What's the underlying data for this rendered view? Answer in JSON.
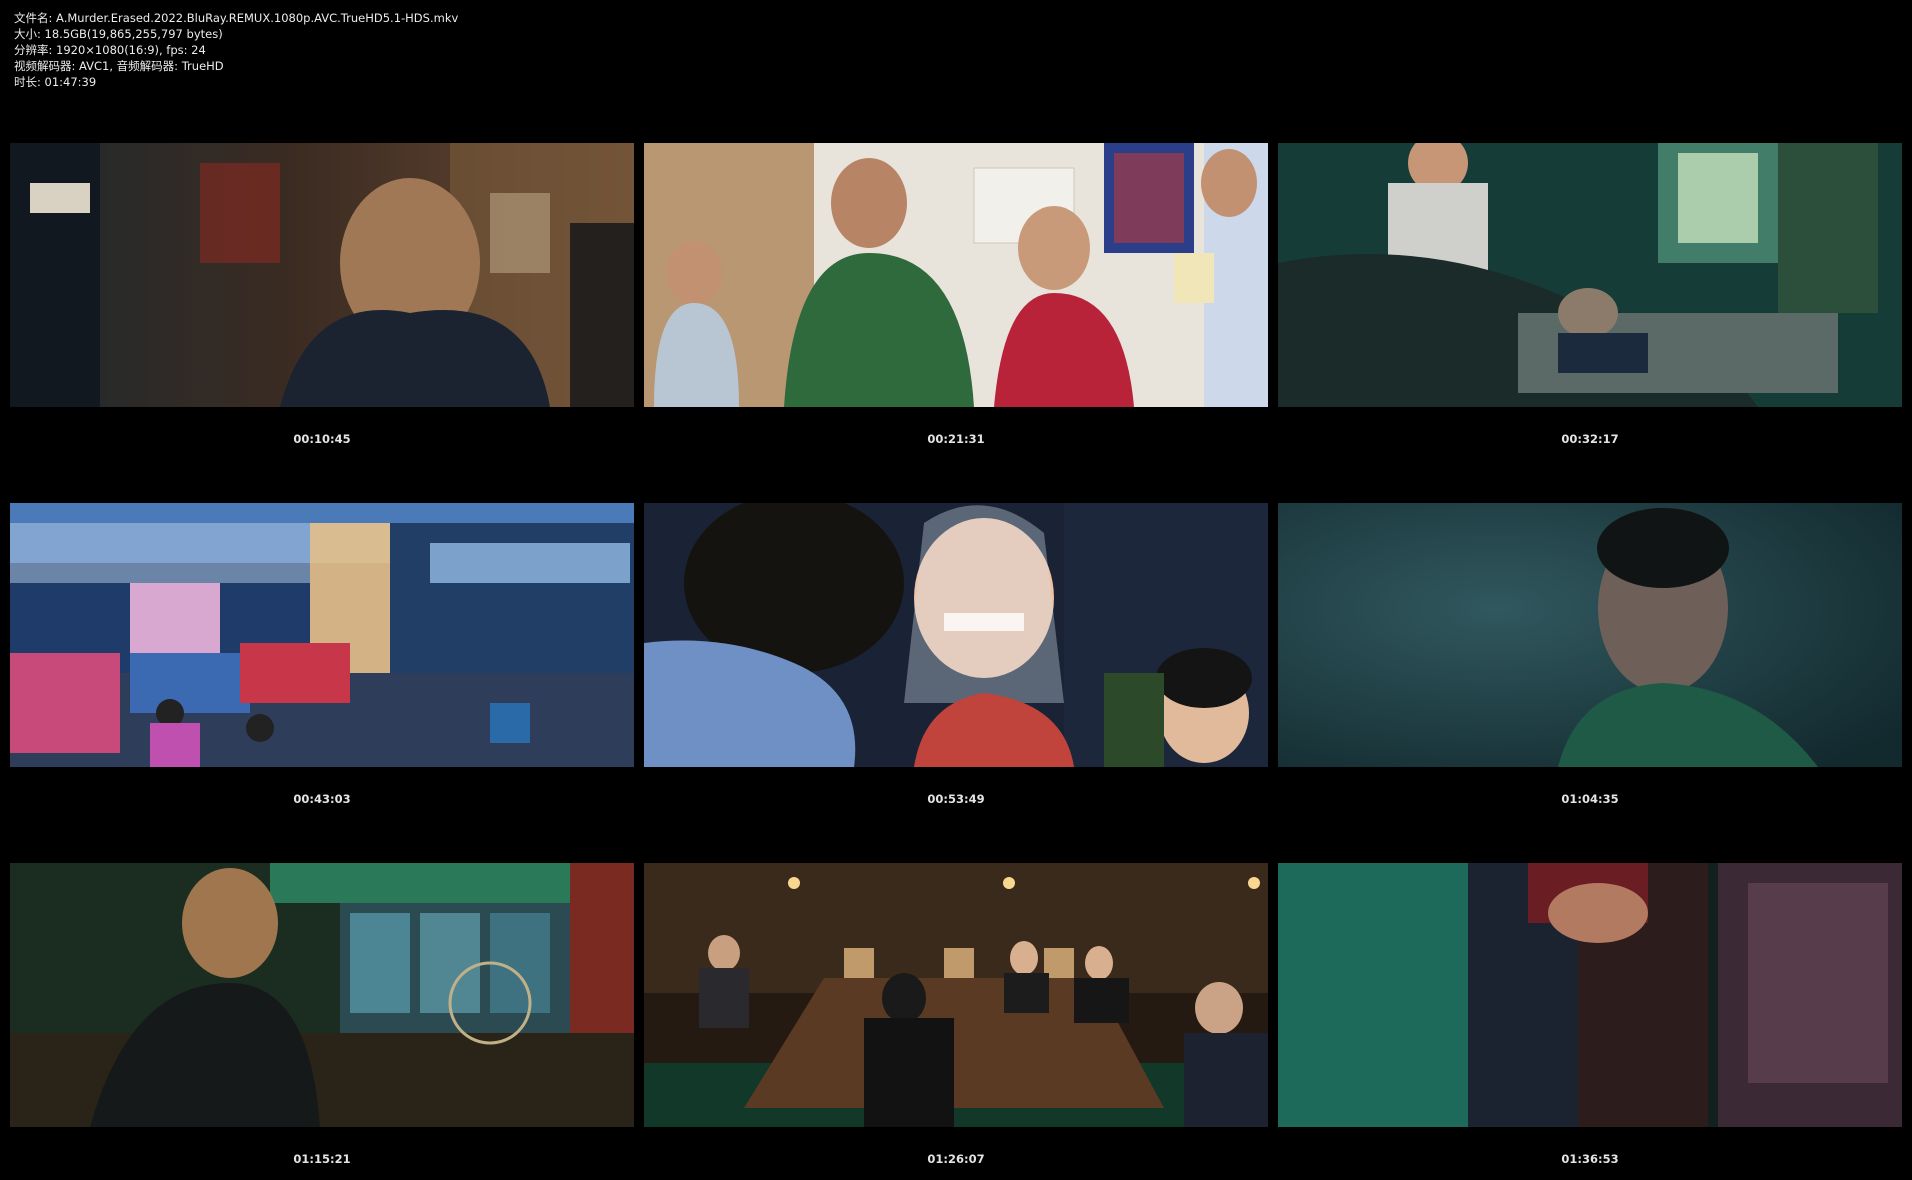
{
  "info": {
    "lines": [
      "文件名: A.Murder.Erased.2022.BluRay.REMUX.1080p.AVC.TrueHD5.1-HDS.mkv",
      "大小: 18.5GB(19,865,255,797 bytes)",
      "分辨率: 1920×1080(16:9), fps: 24",
      "视频解码器: AVC1, 音频解码器: TrueHD",
      "时长: 01:47:39"
    ]
  },
  "thumbnails": [
    {
      "timestamp": "00:10:45",
      "scene": "man-in-cluttered-room"
    },
    {
      "timestamp": "00:21:31",
      "scene": "office-conversation"
    },
    {
      "timestamp": "00:32:17",
      "scene": "green-room-bed"
    },
    {
      "timestamp": "00:43:03",
      "scene": "rainy-street-paper-cars"
    },
    {
      "timestamp": "00:53:49",
      "scene": "smiling-bride"
    },
    {
      "timestamp": "01:04:35",
      "scene": "man-teal-portrait"
    },
    {
      "timestamp": "01:15:21",
      "scene": "man-dark-green-room"
    },
    {
      "timestamp": "01:26:07",
      "scene": "conference-room-meeting"
    },
    {
      "timestamp": "01:36:53",
      "scene": "close-up-hands"
    }
  ]
}
